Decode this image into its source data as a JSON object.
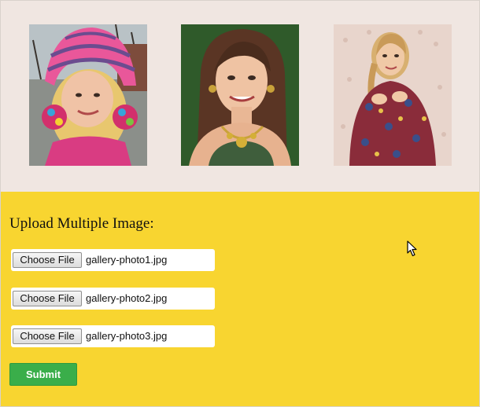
{
  "gallery": {
    "photos": [
      {
        "icon": "photo-girl-pink-hat"
      },
      {
        "icon": "photo-woman-necklace"
      },
      {
        "icon": "photo-woman-braid"
      }
    ]
  },
  "form": {
    "heading": "Upload Multiple Image:",
    "files": [
      {
        "button_label": "Choose File",
        "file_name": "gallery-photo1.jpg"
      },
      {
        "button_label": "Choose File",
        "file_name": "gallery-photo2.jpg"
      },
      {
        "button_label": "Choose File",
        "file_name": "gallery-photo3.jpg"
      }
    ],
    "submit_label": "Submit"
  },
  "colors": {
    "gallery_bg": "#f0e6e1",
    "form_bg": "#f8d530",
    "submit_bg": "#3aae4a"
  }
}
